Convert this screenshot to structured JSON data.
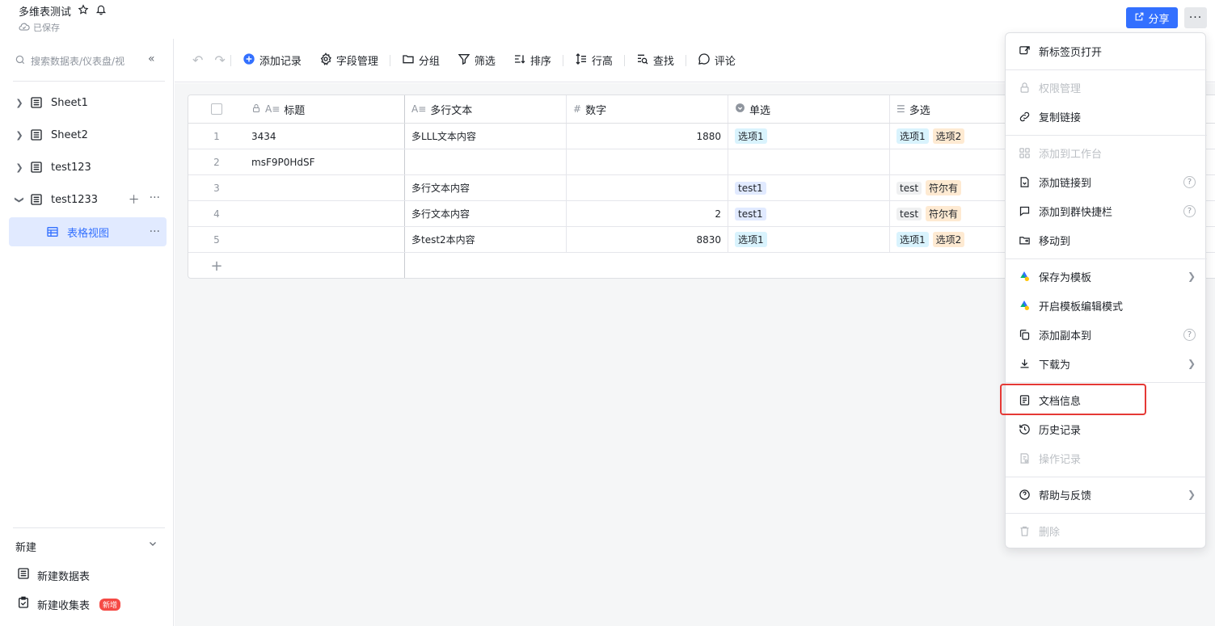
{
  "header": {
    "doc_title": "多维表测试",
    "saved_status": "已保存",
    "share_label": "分享",
    "more_label": "···"
  },
  "sidebar": {
    "search_placeholder": "搜索数据表/仪表盘/视",
    "items": [
      {
        "label": "Sheet1"
      },
      {
        "label": "Sheet2"
      },
      {
        "label": "test123"
      },
      {
        "label": "test1233"
      },
      {
        "label": "表格视图"
      }
    ],
    "new_section": {
      "title": "新建",
      "items": [
        {
          "label": "新建数据表"
        },
        {
          "label": "新建收集表",
          "badge": "新增"
        }
      ]
    }
  },
  "toolbar": {
    "add_record": "添加记录",
    "field_manage": "字段管理",
    "group": "分组",
    "filter": "筛选",
    "sort": "排序",
    "row_height": "行高",
    "find": "查找",
    "comment": "评论"
  },
  "table": {
    "columns": [
      "标题",
      "多行文本",
      "数字",
      "单选",
      "多选"
    ],
    "rows": [
      {
        "idx": "1",
        "title": "3434",
        "text": "多LLL文本内容",
        "num": "1880",
        "single": "选项1",
        "multi": [
          "选项1",
          "选项2"
        ]
      },
      {
        "idx": "2",
        "title": "msF9P0HdSF",
        "text": "",
        "num": "",
        "single": "",
        "multi": []
      },
      {
        "idx": "3",
        "title": "",
        "text": "多行文本内容",
        "num": "",
        "single": "test1",
        "multi": [
          "test",
          "符尔有"
        ]
      },
      {
        "idx": "4",
        "title": "",
        "text": "多行文本内容",
        "num": "2",
        "single": "test1",
        "multi": [
          "test",
          "符尔有"
        ]
      },
      {
        "idx": "5",
        "title": "",
        "text": "多test2本内容",
        "num": "8830",
        "single": "选项1",
        "multi": [
          "选项1",
          "选项2"
        ]
      }
    ],
    "add_row": "+"
  },
  "menu": {
    "items": [
      {
        "label": "新标签页打开"
      },
      {
        "label": "权限管理"
      },
      {
        "label": "复制链接"
      },
      {
        "label": "添加到工作台"
      },
      {
        "label": "添加链接到"
      },
      {
        "label": "添加到群快捷栏"
      },
      {
        "label": "移动到"
      },
      {
        "label": "保存为模板"
      },
      {
        "label": "开启模板编辑模式"
      },
      {
        "label": "添加副本到"
      },
      {
        "label": "下载为"
      },
      {
        "label": "文档信息"
      },
      {
        "label": "历史记录"
      },
      {
        "label": "操作记录"
      },
      {
        "label": "帮助与反馈"
      },
      {
        "label": "删除"
      }
    ]
  },
  "colors": {
    "accent": "#3370ff",
    "highlight_box": "#e53935"
  }
}
